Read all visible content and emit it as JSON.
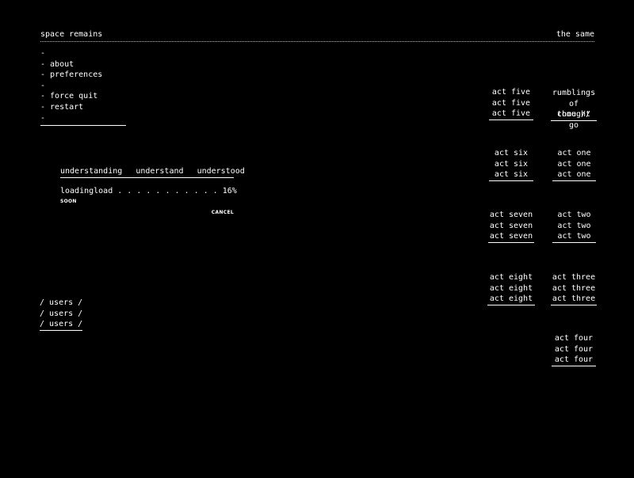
{
  "header": {
    "title_left": "space remains",
    "title_right": "the same"
  },
  "menu": {
    "items": [
      "-",
      "- about",
      "- preferences",
      "-",
      "- force quit",
      "- restart",
      "-"
    ]
  },
  "loader": {
    "tabs": [
      "understanding",
      "understand",
      "understood"
    ],
    "progress_text": "loadingload . . . . . . . . . . . 16%",
    "progress": 0.16,
    "status": "SOON",
    "cancel_label": "CANCEL"
  },
  "acts": {
    "five": [
      "act five",
      "act five",
      "act five"
    ],
    "rumblings": [
      "rumblings",
      "of thought",
      "come // go"
    ],
    "six": [
      "act six",
      "act six",
      "act six"
    ],
    "one": [
      "act one",
      "act one",
      "act one"
    ],
    "seven": [
      "act seven",
      "act seven",
      "act seven"
    ],
    "two": [
      "act two",
      "act two",
      "act two"
    ],
    "eight": [
      "act eight",
      "act eight",
      "act eight"
    ],
    "three": [
      "act three",
      "act three",
      "act three"
    ],
    "four": [
      "act four",
      "act four",
      "act four"
    ]
  },
  "users": [
    "/ users /",
    "/ users /",
    "/ users /"
  ]
}
